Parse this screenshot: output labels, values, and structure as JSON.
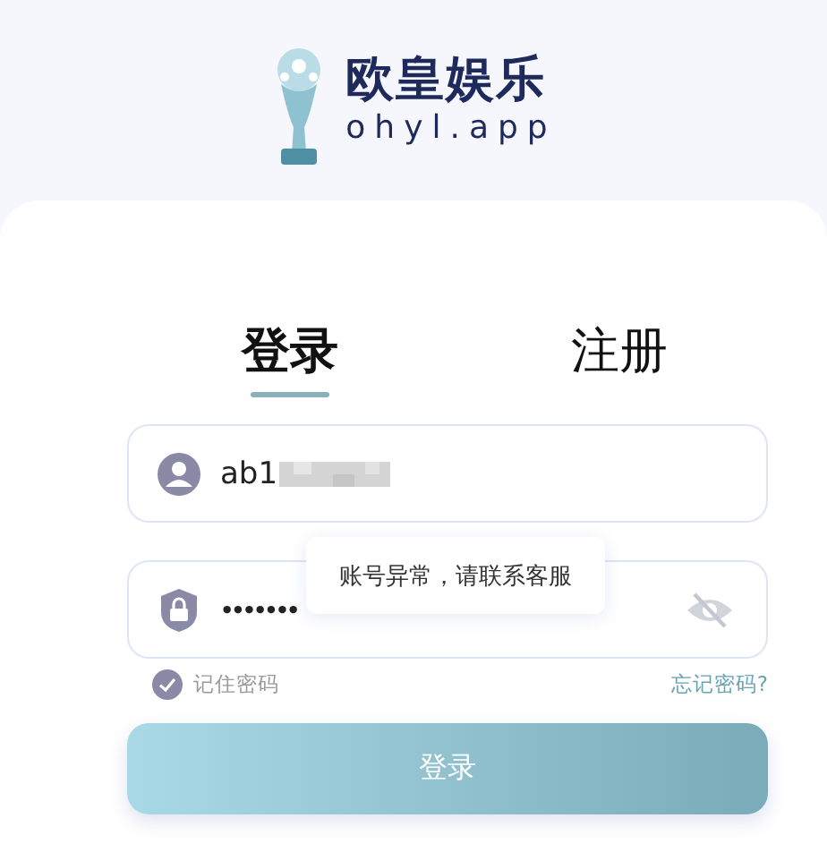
{
  "brand": {
    "name": "欧皇娱乐",
    "domain": "ohyl.app"
  },
  "tabs": [
    {
      "label": "登录",
      "selected": true
    },
    {
      "label": "注册",
      "selected": false
    }
  ],
  "username": {
    "value": "ab1"
  },
  "password": {
    "value": "•••••••"
  },
  "toast": "账号异常，请联系客服",
  "remember": {
    "label": "记住密码",
    "checked": true
  },
  "forgot_link": "忘记密码?",
  "login_button": "登录"
}
